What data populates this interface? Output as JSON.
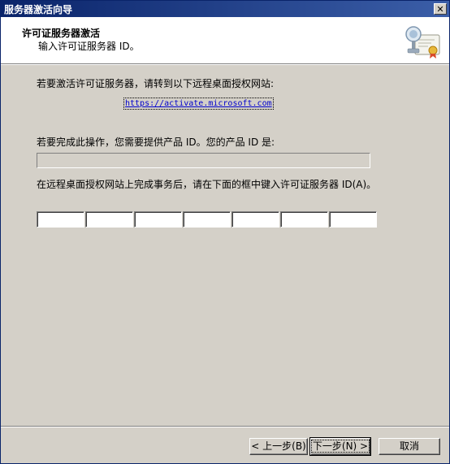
{
  "window": {
    "title": "服务器激活向导",
    "close_symbol": "✕"
  },
  "header": {
    "title": "许可证服务器激活",
    "subtitle": "输入许可证服务器 ID。",
    "icon": "certificate-server-icon"
  },
  "content": {
    "instruction_visit": "若要激活许可证服务器，请转到以下远程桌面授权网站:",
    "activation_url": "https://activate.microsoft.com",
    "instruction_product_id": "若要完成此操作，您需要提供产品 ID。您的产品 ID 是:",
    "product_id_value": "",
    "instruction_enter_id": "在远程桌面授权网站上完成事务后，请在下面的框中键入许可证服务器 ID(A)。",
    "license_server_id_fields": [
      "",
      "",
      "",
      "",
      "",
      "",
      ""
    ]
  },
  "buttons": {
    "back": "< 上一步(B)",
    "next": "下一步(N) >",
    "cancel": "取消"
  }
}
